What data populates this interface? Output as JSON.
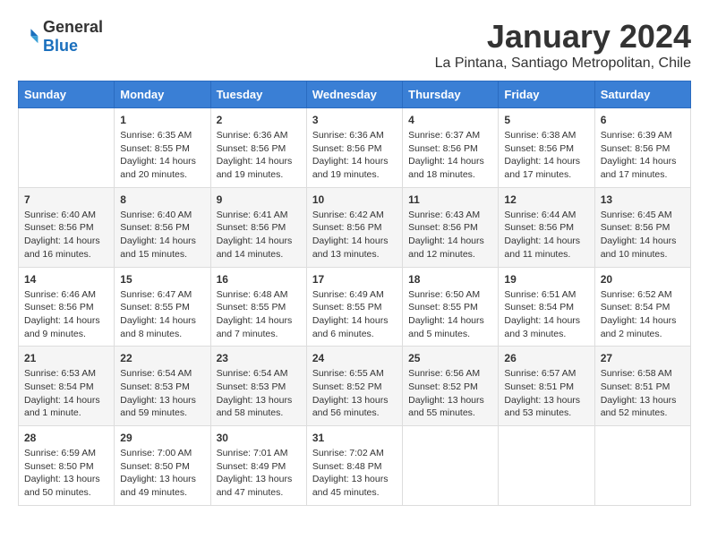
{
  "logo": {
    "general": "General",
    "blue": "Blue"
  },
  "title": "January 2024",
  "location": "La Pintana, Santiago Metropolitan, Chile",
  "days_of_week": [
    "Sunday",
    "Monday",
    "Tuesday",
    "Wednesday",
    "Thursday",
    "Friday",
    "Saturday"
  ],
  "weeks": [
    [
      {
        "day": "",
        "detail": ""
      },
      {
        "day": "1",
        "detail": "Sunrise: 6:35 AM\nSunset: 8:55 PM\nDaylight: 14 hours\nand 20 minutes."
      },
      {
        "day": "2",
        "detail": "Sunrise: 6:36 AM\nSunset: 8:56 PM\nDaylight: 14 hours\nand 19 minutes."
      },
      {
        "day": "3",
        "detail": "Sunrise: 6:36 AM\nSunset: 8:56 PM\nDaylight: 14 hours\nand 19 minutes."
      },
      {
        "day": "4",
        "detail": "Sunrise: 6:37 AM\nSunset: 8:56 PM\nDaylight: 14 hours\nand 18 minutes."
      },
      {
        "day": "5",
        "detail": "Sunrise: 6:38 AM\nSunset: 8:56 PM\nDaylight: 14 hours\nand 17 minutes."
      },
      {
        "day": "6",
        "detail": "Sunrise: 6:39 AM\nSunset: 8:56 PM\nDaylight: 14 hours\nand 17 minutes."
      }
    ],
    [
      {
        "day": "7",
        "detail": "Sunrise: 6:40 AM\nSunset: 8:56 PM\nDaylight: 14 hours\nand 16 minutes."
      },
      {
        "day": "8",
        "detail": "Sunrise: 6:40 AM\nSunset: 8:56 PM\nDaylight: 14 hours\nand 15 minutes."
      },
      {
        "day": "9",
        "detail": "Sunrise: 6:41 AM\nSunset: 8:56 PM\nDaylight: 14 hours\nand 14 minutes."
      },
      {
        "day": "10",
        "detail": "Sunrise: 6:42 AM\nSunset: 8:56 PM\nDaylight: 14 hours\nand 13 minutes."
      },
      {
        "day": "11",
        "detail": "Sunrise: 6:43 AM\nSunset: 8:56 PM\nDaylight: 14 hours\nand 12 minutes."
      },
      {
        "day": "12",
        "detail": "Sunrise: 6:44 AM\nSunset: 8:56 PM\nDaylight: 14 hours\nand 11 minutes."
      },
      {
        "day": "13",
        "detail": "Sunrise: 6:45 AM\nSunset: 8:56 PM\nDaylight: 14 hours\nand 10 minutes."
      }
    ],
    [
      {
        "day": "14",
        "detail": "Sunrise: 6:46 AM\nSunset: 8:56 PM\nDaylight: 14 hours\nand 9 minutes."
      },
      {
        "day": "15",
        "detail": "Sunrise: 6:47 AM\nSunset: 8:55 PM\nDaylight: 14 hours\nand 8 minutes."
      },
      {
        "day": "16",
        "detail": "Sunrise: 6:48 AM\nSunset: 8:55 PM\nDaylight: 14 hours\nand 7 minutes."
      },
      {
        "day": "17",
        "detail": "Sunrise: 6:49 AM\nSunset: 8:55 PM\nDaylight: 14 hours\nand 6 minutes."
      },
      {
        "day": "18",
        "detail": "Sunrise: 6:50 AM\nSunset: 8:55 PM\nDaylight: 14 hours\nand 5 minutes."
      },
      {
        "day": "19",
        "detail": "Sunrise: 6:51 AM\nSunset: 8:54 PM\nDaylight: 14 hours\nand 3 minutes."
      },
      {
        "day": "20",
        "detail": "Sunrise: 6:52 AM\nSunset: 8:54 PM\nDaylight: 14 hours\nand 2 minutes."
      }
    ],
    [
      {
        "day": "21",
        "detail": "Sunrise: 6:53 AM\nSunset: 8:54 PM\nDaylight: 14 hours\nand 1 minute."
      },
      {
        "day": "22",
        "detail": "Sunrise: 6:54 AM\nSunset: 8:53 PM\nDaylight: 13 hours\nand 59 minutes."
      },
      {
        "day": "23",
        "detail": "Sunrise: 6:54 AM\nSunset: 8:53 PM\nDaylight: 13 hours\nand 58 minutes."
      },
      {
        "day": "24",
        "detail": "Sunrise: 6:55 AM\nSunset: 8:52 PM\nDaylight: 13 hours\nand 56 minutes."
      },
      {
        "day": "25",
        "detail": "Sunrise: 6:56 AM\nSunset: 8:52 PM\nDaylight: 13 hours\nand 55 minutes."
      },
      {
        "day": "26",
        "detail": "Sunrise: 6:57 AM\nSunset: 8:51 PM\nDaylight: 13 hours\nand 53 minutes."
      },
      {
        "day": "27",
        "detail": "Sunrise: 6:58 AM\nSunset: 8:51 PM\nDaylight: 13 hours\nand 52 minutes."
      }
    ],
    [
      {
        "day": "28",
        "detail": "Sunrise: 6:59 AM\nSunset: 8:50 PM\nDaylight: 13 hours\nand 50 minutes."
      },
      {
        "day": "29",
        "detail": "Sunrise: 7:00 AM\nSunset: 8:50 PM\nDaylight: 13 hours\nand 49 minutes."
      },
      {
        "day": "30",
        "detail": "Sunrise: 7:01 AM\nSunset: 8:49 PM\nDaylight: 13 hours\nand 47 minutes."
      },
      {
        "day": "31",
        "detail": "Sunrise: 7:02 AM\nSunset: 8:48 PM\nDaylight: 13 hours\nand 45 minutes."
      },
      {
        "day": "",
        "detail": ""
      },
      {
        "day": "",
        "detail": ""
      },
      {
        "day": "",
        "detail": ""
      }
    ]
  ]
}
